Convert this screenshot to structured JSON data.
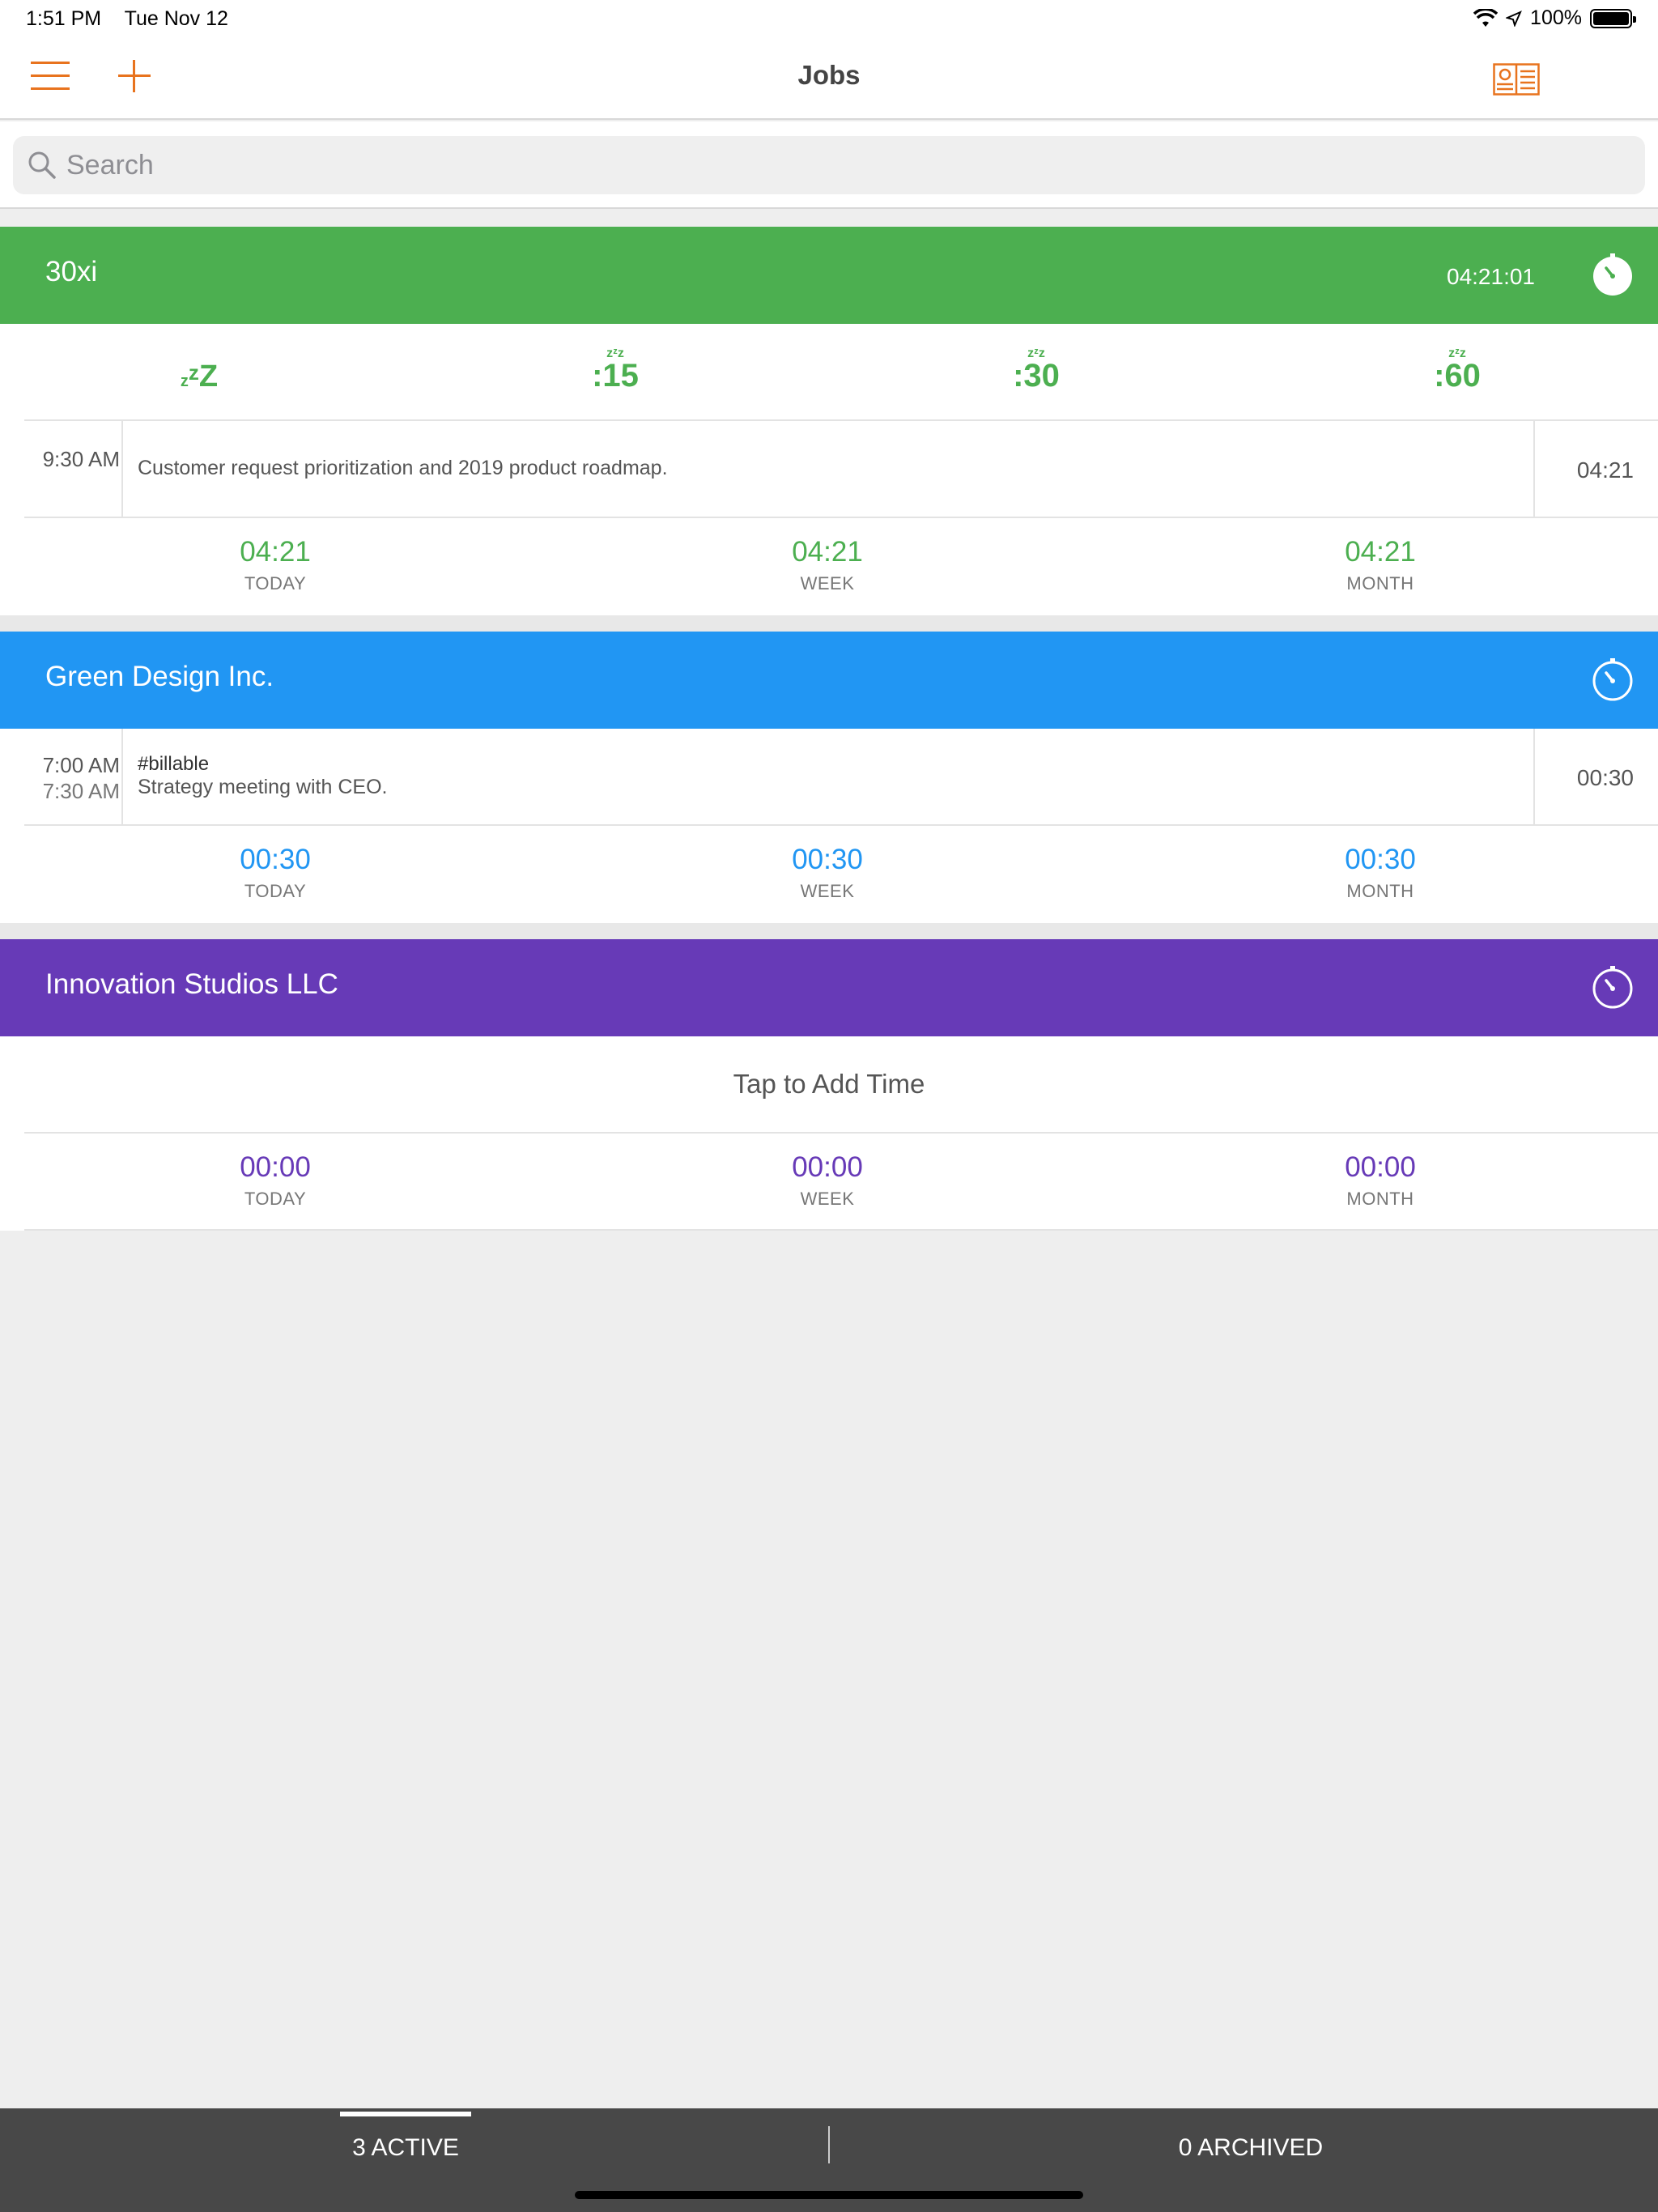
{
  "status_bar": {
    "time": "1:51 PM",
    "date": "Tue Nov 12",
    "battery": "100%"
  },
  "nav": {
    "title": "Jobs",
    "menu_icon": "hamburger-icon",
    "add_icon": "plus-icon",
    "report_icon": "report-icon",
    "accent_color": "#e8731e"
  },
  "search": {
    "placeholder": "Search"
  },
  "jobs": [
    {
      "name": "30xi",
      "color": "#4caf50",
      "timer": "04:21:01",
      "quick_buttons": [
        {
          "zz": "",
          "label": "zZZ"
        },
        {
          "zz": "zᶻz",
          "label": ":15"
        },
        {
          "zz": "zᶻz",
          "label": ":30"
        },
        {
          "zz": "zᶻz",
          "label": ":60"
        }
      ],
      "entries": [
        {
          "start": "9:30 AM",
          "end": "",
          "tag": "",
          "note": "Customer request prioritization and 2019 product roadmap.",
          "duration": "04:21"
        }
      ],
      "totals": [
        {
          "value": "04:21",
          "label": "TODAY"
        },
        {
          "value": "04:21",
          "label": "WEEK"
        },
        {
          "value": "04:21",
          "label": "MONTH"
        }
      ]
    },
    {
      "name": "Green Design Inc.",
      "color": "#2196f3",
      "timer": "",
      "entries": [
        {
          "start": "7:00 AM",
          "end": "7:30 AM",
          "tag": "#billable",
          "note": "Strategy meeting with CEO.",
          "duration": "00:30"
        }
      ],
      "totals": [
        {
          "value": "00:30",
          "label": "TODAY"
        },
        {
          "value": "00:30",
          "label": "WEEK"
        },
        {
          "value": "00:30",
          "label": "MONTH"
        }
      ]
    },
    {
      "name": "Innovation Studios LLC",
      "color": "#673ab7",
      "timer": "",
      "tap_to_add": "Tap to Add Time",
      "totals": [
        {
          "value": "00:00",
          "label": "TODAY"
        },
        {
          "value": "00:00",
          "label": "WEEK"
        },
        {
          "value": "00:00",
          "label": "MONTH"
        }
      ]
    }
  ],
  "tabs": {
    "active": "3 ACTIVE",
    "archived": "0 ARCHIVED"
  }
}
